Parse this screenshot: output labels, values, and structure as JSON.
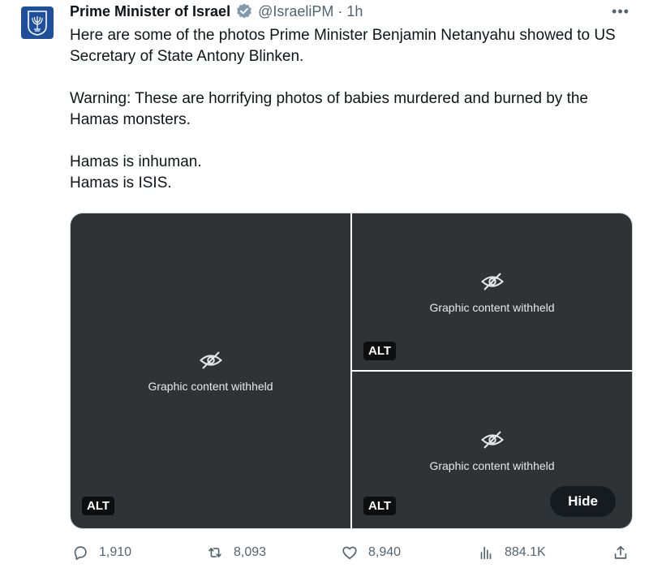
{
  "tweet": {
    "author_name": "Prime Minister of Israel",
    "handle": "@IsraeliPM",
    "separator": "·",
    "time": "1h",
    "more_icon": "ellipsis-icon",
    "verified_icon": "verified-badge-icon",
    "text": {
      "paragraph_1": "Here are some of the photos Prime Minister Benjamin Netanyahu showed to US Secretary of State Antony Blinken.",
      "paragraph_2": "Warning: These are horrifying photos of babies murdered and burned by the Hamas monsters.",
      "line_3": "Hamas is inhuman.",
      "line_4": "Hamas is ISIS."
    }
  },
  "media": {
    "placeholder_label": "Graphic content withheld",
    "photos": [
      {
        "alt_badge": "ALT"
      },
      {
        "alt_badge": "ALT"
      },
      {
        "alt_badge": "ALT"
      }
    ],
    "hide_button": "Hide"
  },
  "actions": {
    "replies": "1,910",
    "reposts": "8,093",
    "likes": "8,940",
    "views": "884.1K",
    "icons": [
      "reply-icon",
      "repost-icon",
      "like-icon",
      "views-icon",
      "share-icon"
    ]
  },
  "colors": {
    "text_primary": "#0f1419",
    "text_secondary": "#536471",
    "verified_blue": "#1d9bf0",
    "avatar_blue": "#1d4f9c",
    "border": "#cfd9de"
  }
}
